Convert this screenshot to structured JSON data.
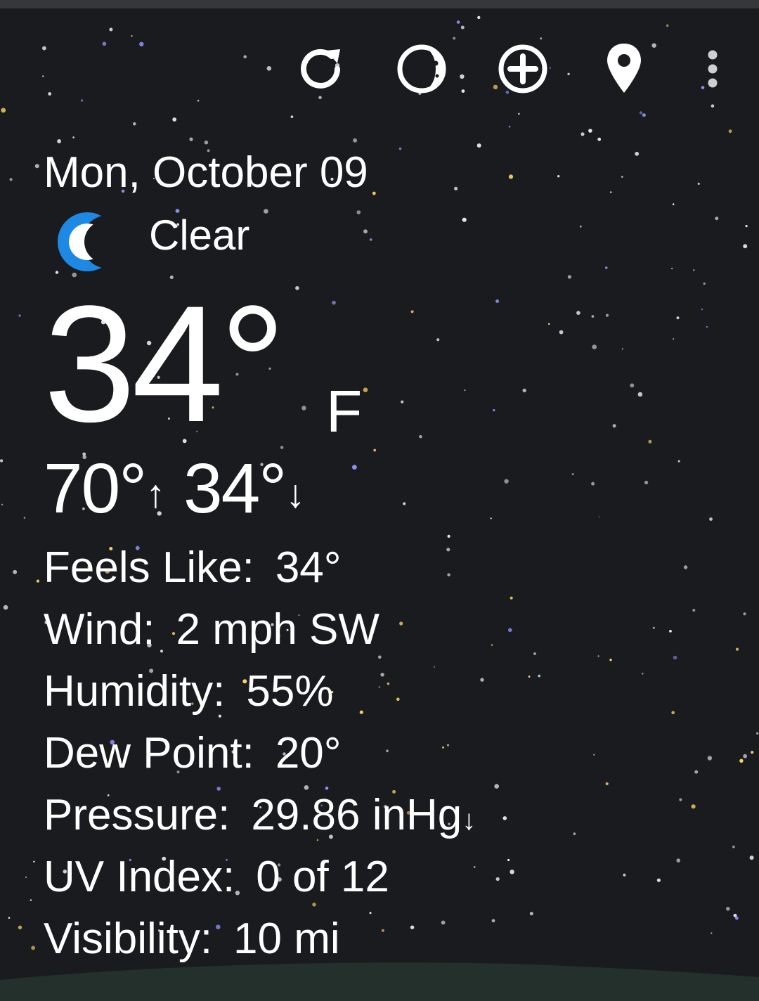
{
  "colors": {
    "background": "#1a1b1e",
    "text": "#ffffff",
    "moon_icon": "#1e88e5",
    "star_white": "#e6eefc",
    "star_yellow": "#ffd36a",
    "star_blue": "#8f96ff",
    "hill": "#23302c"
  },
  "toolbar": {
    "icons": [
      "refresh-icon",
      "moon-phase-icon",
      "add-location-icon",
      "location-pin-icon",
      "more-vert-icon"
    ]
  },
  "weather": {
    "date": "Mon, October 09",
    "condition": "Clear",
    "condition_icon": "crescent-moon-icon",
    "temperature": "34°",
    "unit": "F",
    "high": "70°",
    "high_arrow": "↑",
    "low": "34°",
    "low_arrow": "↓"
  },
  "details": [
    {
      "label": "Feels Like:",
      "value": "34°"
    },
    {
      "label": "Wind:",
      "value": "2 mph SW"
    },
    {
      "label": "Humidity:",
      "value": "55%"
    },
    {
      "label": "Dew Point:",
      "value": "20°"
    },
    {
      "label": "Pressure:",
      "value": "29.86 inHg",
      "trend": "↓"
    },
    {
      "label": "UV Index:",
      "value": "0 of 12"
    },
    {
      "label": "Visibility:",
      "value": "10 mi"
    }
  ]
}
